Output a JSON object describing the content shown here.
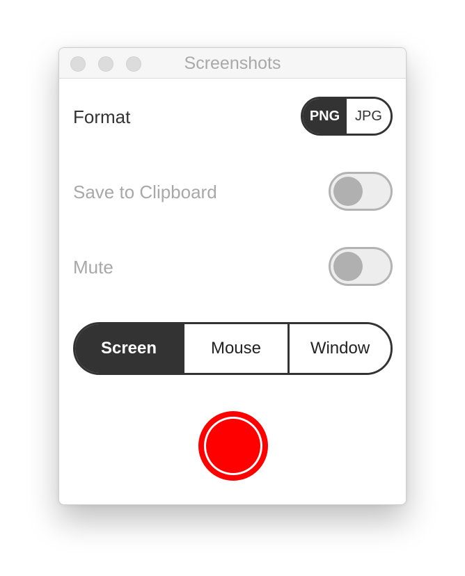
{
  "window": {
    "title": "Screenshots"
  },
  "format": {
    "label": "Format",
    "options": [
      "PNG",
      "JPG"
    ],
    "selected": "PNG"
  },
  "clipboard": {
    "label": "Save to Clipboard",
    "enabled": false
  },
  "mute": {
    "label": "Mute",
    "enabled": false
  },
  "capture_mode": {
    "options": [
      "Screen",
      "Mouse",
      "Window"
    ],
    "selected": "Screen"
  },
  "record_button": {
    "icon": "record-icon",
    "color": "#ff0000"
  },
  "colors": {
    "accent_dark": "#333333",
    "disabled_text": "#a8a8a8",
    "record": "#ff0000"
  }
}
